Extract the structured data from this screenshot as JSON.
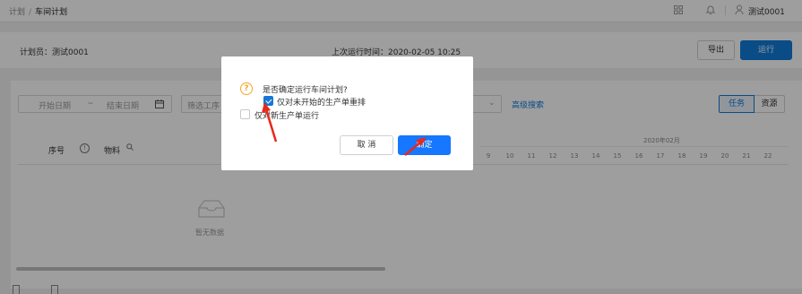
{
  "breadcrumb": {
    "parent": "计划",
    "separator": "/",
    "current": "车间计划"
  },
  "topbar": {
    "user_name": "测试0001"
  },
  "header": {
    "planner": "计划员：测试0001",
    "last_run": "上次运行时间：2020-02-05 10:25",
    "export_label": "导出",
    "run_label": "运行"
  },
  "filters": {
    "start_placeholder": "开始日期",
    "date_separator": "~",
    "end_placeholder": "结束日期",
    "workshop_placeholder": "筛选工序",
    "advanced_search": "高级搜索"
  },
  "view_tabs": {
    "task": "任务",
    "resource": "资源"
  },
  "table": {
    "col_index": "序号",
    "col_material": "物料",
    "month_label": "2020年02月",
    "days": [
      "9",
      "10",
      "11",
      "12",
      "13",
      "14",
      "15",
      "16",
      "17",
      "18",
      "19",
      "20",
      "21",
      "22"
    ],
    "empty_text": "暂无数据"
  },
  "dialog": {
    "question": "是否确定运行车间计划?",
    "option1_label": "仅对未开始的生产单重排",
    "option1_checked": true,
    "option2_label": "仅对新生产单运行",
    "option2_checked": false,
    "cancel_label": "取 消",
    "confirm_label": "确定"
  },
  "colors": {
    "primary": "#0f7bd9",
    "warning": "#f5a623",
    "annotation": "#e8291c"
  }
}
